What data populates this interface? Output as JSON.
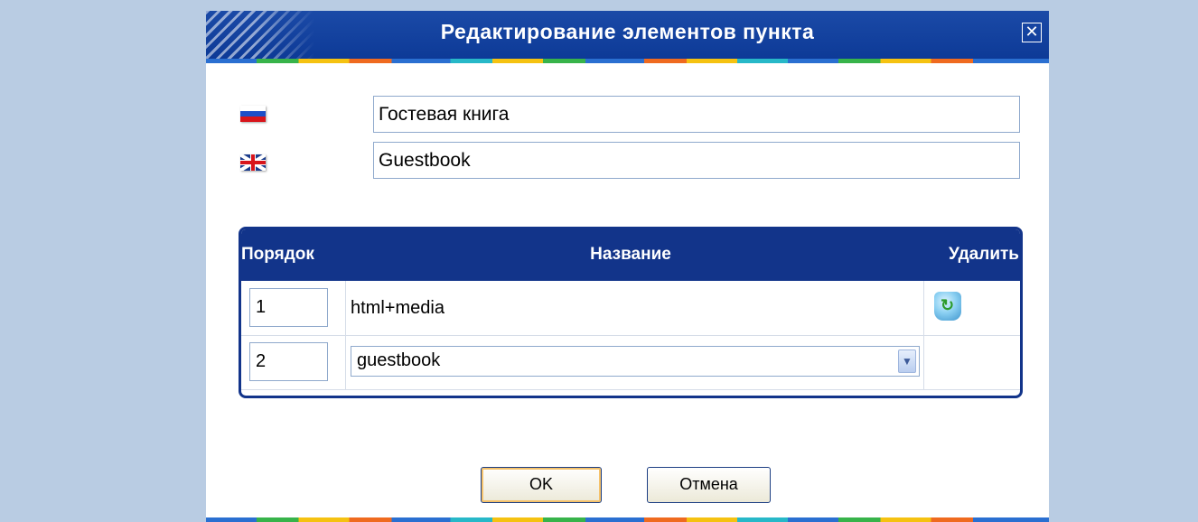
{
  "dialog": {
    "title": "Редактирование элементов пункта",
    "close_label": "✕"
  },
  "languages": [
    {
      "flag": "russia-flag-icon",
      "value": "Гостевая книга"
    },
    {
      "flag": "uk-flag-icon",
      "value": "Guestbook"
    }
  ],
  "table": {
    "headers": {
      "order": "Порядок",
      "name": "Название",
      "delete": "Удалить"
    },
    "rows": [
      {
        "order": "1",
        "name": "html+media",
        "delete_icon": "recycle-bin-icon"
      },
      {
        "order": "2",
        "name": "guestbook",
        "type": "select"
      }
    ]
  },
  "buttons": {
    "ok": "OK",
    "cancel": "Отмена"
  },
  "colors": {
    "page_background": "#b9cce3",
    "titlebar": "#12348a",
    "table_header": "#12348a"
  }
}
